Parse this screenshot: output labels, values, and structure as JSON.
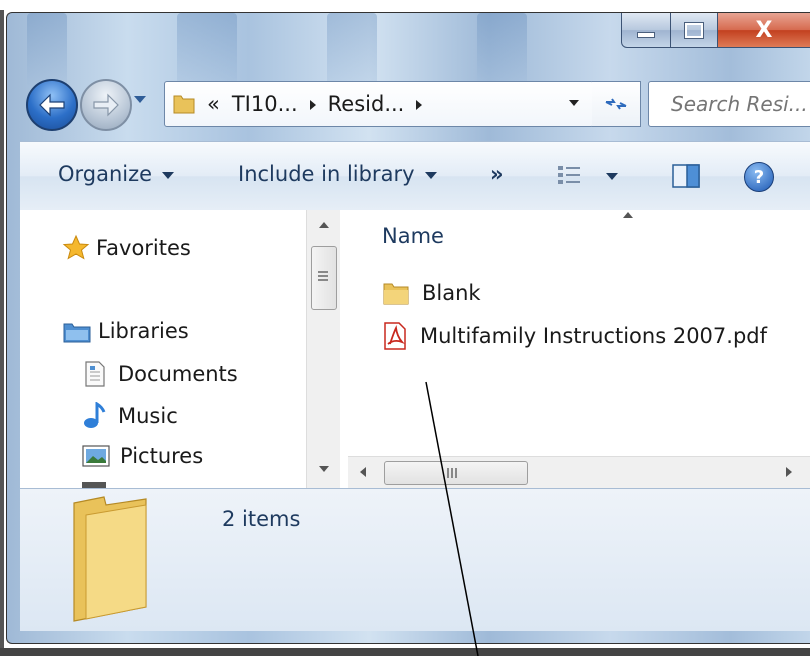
{
  "window": {
    "controls": {
      "minimize": "–",
      "maximize": "□",
      "close": "X"
    }
  },
  "navigation": {
    "breadcrumb_overflow": "«",
    "breadcrumb": [
      "TI10...",
      "Resid..."
    ],
    "search_placeholder": "Search Resi..."
  },
  "toolbar": {
    "organize": "Organize",
    "include_in_library": "Include in library",
    "more": "»"
  },
  "nav_pane": {
    "favorites": "Favorites",
    "libraries": "Libraries",
    "library_items": [
      "Documents",
      "Music",
      "Pictures"
    ]
  },
  "file_list": {
    "column_name": "Name",
    "items": [
      {
        "name": "Blank",
        "type": "folder"
      },
      {
        "name": "Multifamily Instructions 2007.pdf",
        "type": "pdf"
      }
    ]
  },
  "details": {
    "item_count": "2 items"
  },
  "colors": {
    "accent": "#2c6fc8",
    "folder": "#e9c25a",
    "pdf": "#c8281e"
  }
}
